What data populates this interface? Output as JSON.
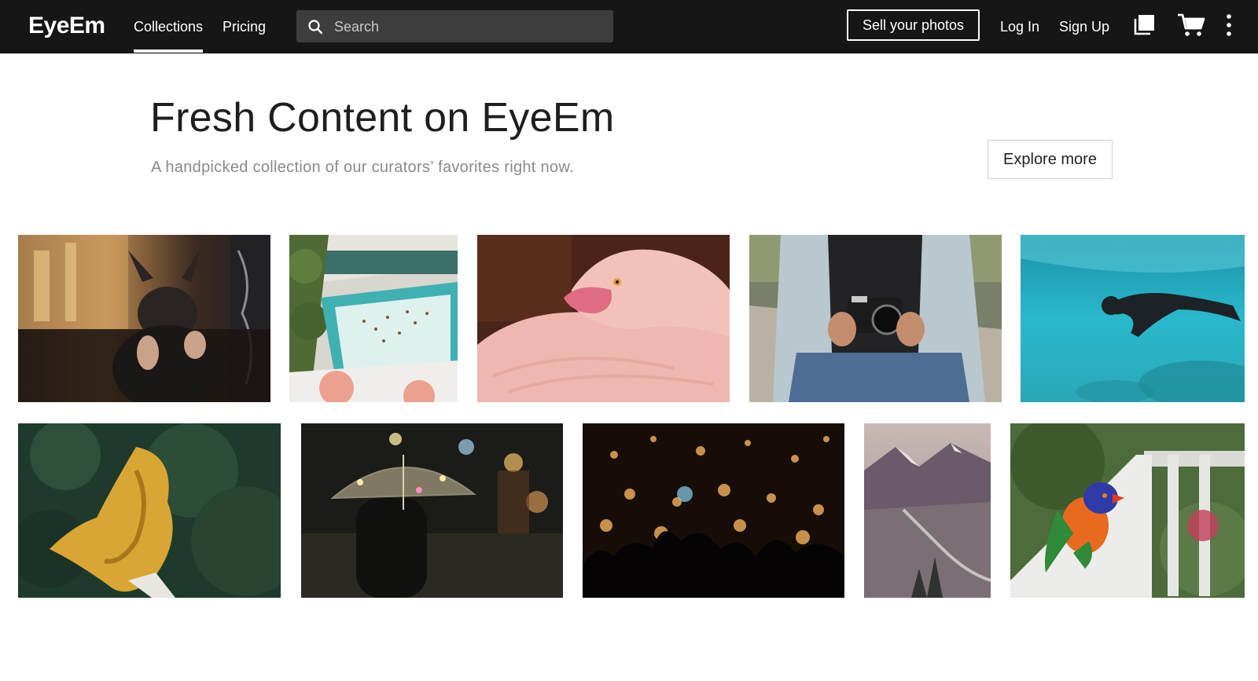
{
  "header": {
    "logo": "EyeEm",
    "nav": [
      {
        "label": "Collections",
        "active": true
      },
      {
        "label": "Pricing",
        "active": false
      }
    ],
    "search": {
      "placeholder": "Search",
      "icon": "search-icon"
    },
    "sell_button": "Sell your photos",
    "login": "Log In",
    "signup": "Sign Up",
    "icons": [
      "collections-icon",
      "cart-icon",
      "more-vertical-icon"
    ]
  },
  "hero": {
    "title": "Fresh Content on EyeEm",
    "subtitle": "A handpicked collection of our curators’ favorites right now.",
    "explore_button": "Explore more"
  },
  "photos": [
    {
      "row": 1,
      "subject": "french-bulldog"
    },
    {
      "row": 1,
      "subject": "aerial-pool"
    },
    {
      "row": 1,
      "subject": "pink-flamingo"
    },
    {
      "row": 1,
      "subject": "person-holding-camera"
    },
    {
      "row": 1,
      "subject": "underwater-diver"
    },
    {
      "row": 2,
      "subject": "yellow-fabric"
    },
    {
      "row": 2,
      "subject": "clear-umbrella-night"
    },
    {
      "row": 2,
      "subject": "crowd-bokeh-lights"
    },
    {
      "row": 2,
      "subject": "mountain-lake-road"
    },
    {
      "row": 2,
      "subject": "rainbow-lorikeet"
    }
  ],
  "colors": {
    "topbar_bg": "#161616",
    "search_bg": "#3d3d3d",
    "text_dark": "#1e1e1e",
    "subtitle_gray": "#8a8a8a"
  }
}
